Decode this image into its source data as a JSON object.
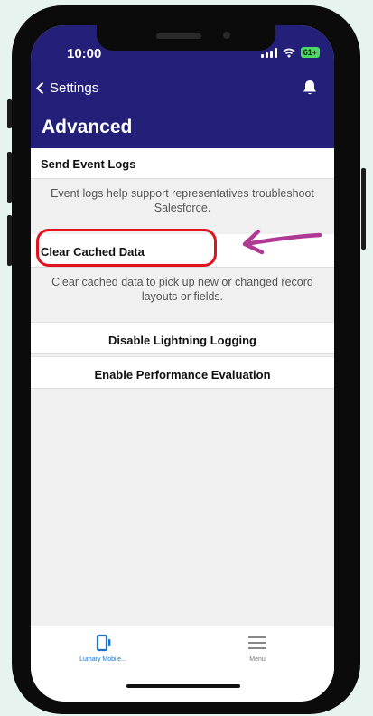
{
  "status_bar": {
    "time": "10:00",
    "battery": "61+"
  },
  "nav": {
    "back_label": "Settings",
    "title": "Advanced"
  },
  "rows": {
    "send_event_logs": "Send Event Logs",
    "send_event_logs_help": "Event logs help support representatives troubleshoot Salesforce.",
    "clear_cached_data": "Clear Cached Data",
    "clear_cached_data_help": "Clear cached data to pick up new or changed record layouts or fields.",
    "disable_lightning_logging": "Disable Lightning Logging",
    "enable_performance_evaluation": "Enable Performance Evaluation"
  },
  "tabbar": {
    "app_tab": "Lumary Mobile...",
    "menu_tab": "Menu"
  },
  "colors": {
    "header": "#24207a",
    "accent": "#1a73c9",
    "highlight": "#e0141e",
    "arrow": "#b03a93"
  },
  "icons": [
    "chevron-left-icon",
    "bell-icon",
    "phone-app-icon",
    "hamburger-menu-icon"
  ]
}
